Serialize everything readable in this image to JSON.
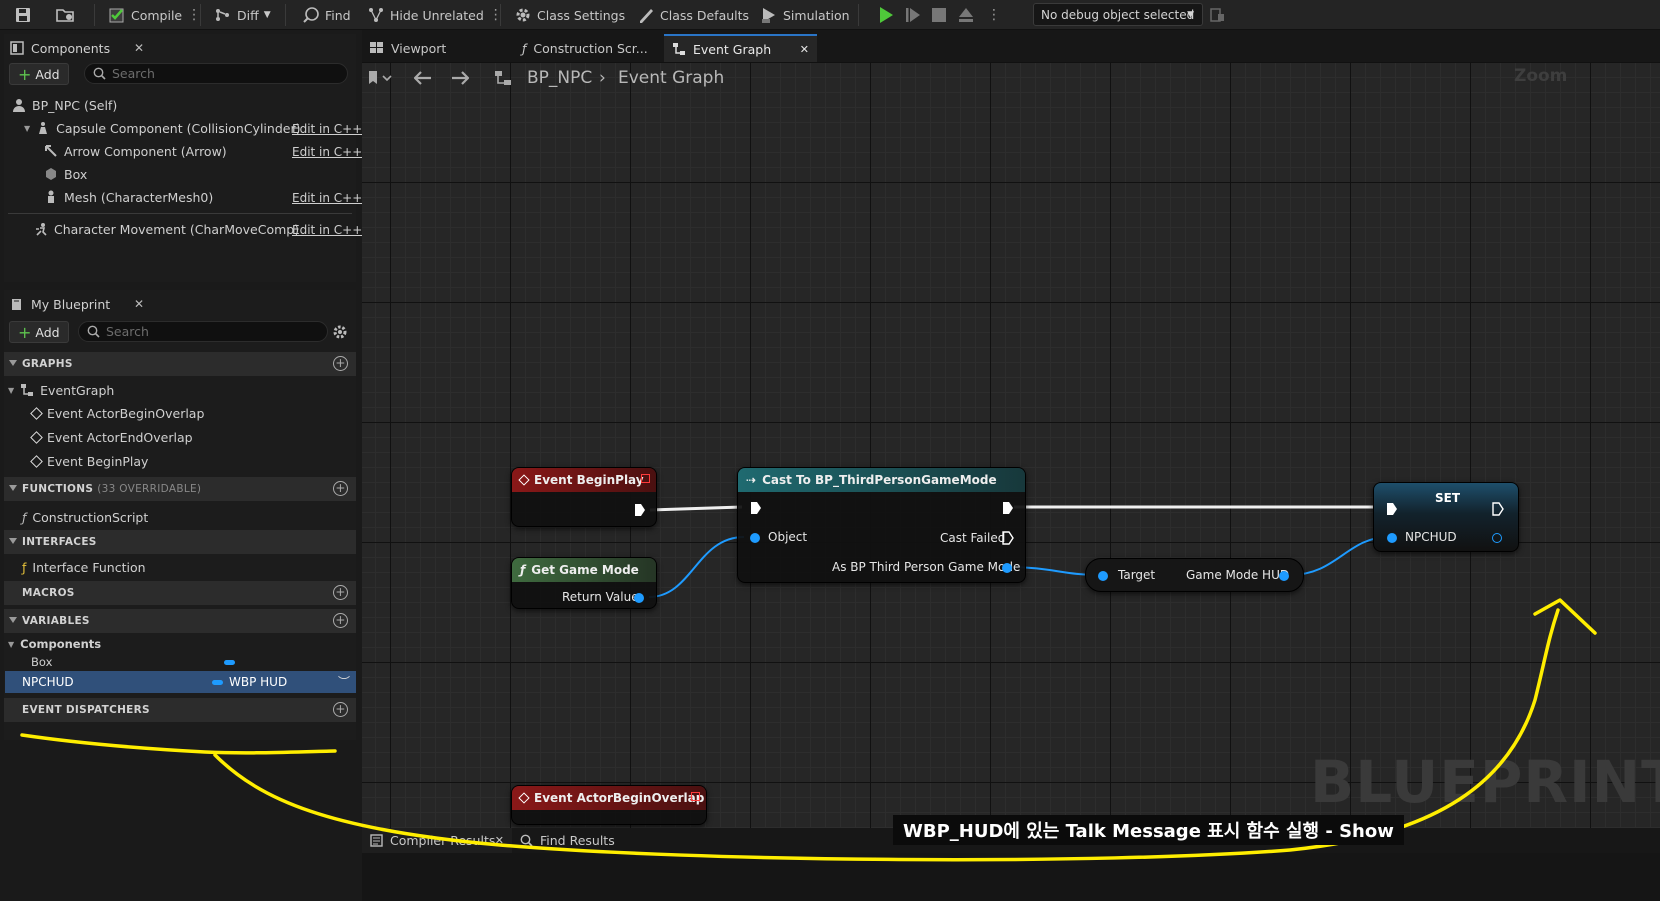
{
  "toolbar": {
    "compile": "Compile",
    "diff": "Diff",
    "find": "Find",
    "hide_unrelated": "Hide Unrelated",
    "class_settings": "Class Settings",
    "class_defaults": "Class Defaults",
    "simulation": "Simulation",
    "debug_object": "No debug object selected"
  },
  "components_panel": {
    "tab": "Components",
    "add": "Add",
    "search_placeholder": "Search",
    "root": "BP_NPC (Self)",
    "items": [
      {
        "label": "Capsule Component (CollisionCylinder)",
        "action": "Edit in C++"
      },
      {
        "label": "Arrow Component (Arrow)",
        "action": "Edit in C++"
      },
      {
        "label": "Box",
        "action": ""
      },
      {
        "label": "Mesh (CharacterMesh0)",
        "action": "Edit in C++"
      },
      {
        "label": "Character Movement (CharMoveComp)",
        "action": "Edit in C++"
      }
    ]
  },
  "my_blueprint": {
    "tab": "My Blueprint",
    "add": "Add",
    "search_placeholder": "Search",
    "graphs_header": "GRAPHS",
    "event_graph": "EventGraph",
    "events": [
      "Event ActorBeginOverlap",
      "Event ActorEndOverlap",
      "Event BeginPlay"
    ],
    "functions_header": "FUNCTIONS",
    "functions_sub": "(33 OVERRIDABLE)",
    "construction_script": "ConstructionScript",
    "interfaces_header": "INTERFACES",
    "interface_function": "Interface Function",
    "macros_header": "MACROS",
    "variables_header": "VARIABLES",
    "components_group": "Components",
    "var_box": "Box",
    "var_npchud": "NPCHUD",
    "var_npchud_type": "WBP HUD",
    "dispatchers_header": "EVENT DISPATCHERS"
  },
  "editor_tabs": {
    "viewport": "Viewport",
    "construction": "Construction Scr...",
    "event_graph": "Event Graph"
  },
  "breadcrumb": {
    "blueprint": "BP_NPC",
    "graph": "Event Graph",
    "zoom": "Zoom"
  },
  "nodes": {
    "begin_play": "Event BeginPlay",
    "get_game_mode": "Get Game Mode",
    "return_value": "Return Value",
    "cast_title": "Cast To BP_ThirdPersonGameMode",
    "object_pin": "Object",
    "cast_failed": "Cast Failed",
    "as_bp": "As BP Third Person Game Mode",
    "target": "Target",
    "game_mode_hud": "Game Mode HUD",
    "set_title": "SET",
    "npchud_pin": "NPCHUD",
    "begin_overlap": "Event ActorBeginOverlap"
  },
  "bottom_tabs": {
    "compiler_results": "Compiler Results",
    "find_results": "Find Results"
  },
  "watermark": "BLUEPRINT",
  "subtitle": "WBP_HUD에 있는 Talk Message 표시 함수 실행 - Show",
  "colors": {
    "accent": "#2a75c7",
    "event_red": "#7a1414",
    "func_green": "#2f4f2f",
    "cast_teal": "#1d5a60",
    "pin_blue": "#1e9bff",
    "annotation_yellow": "#ffee00"
  }
}
